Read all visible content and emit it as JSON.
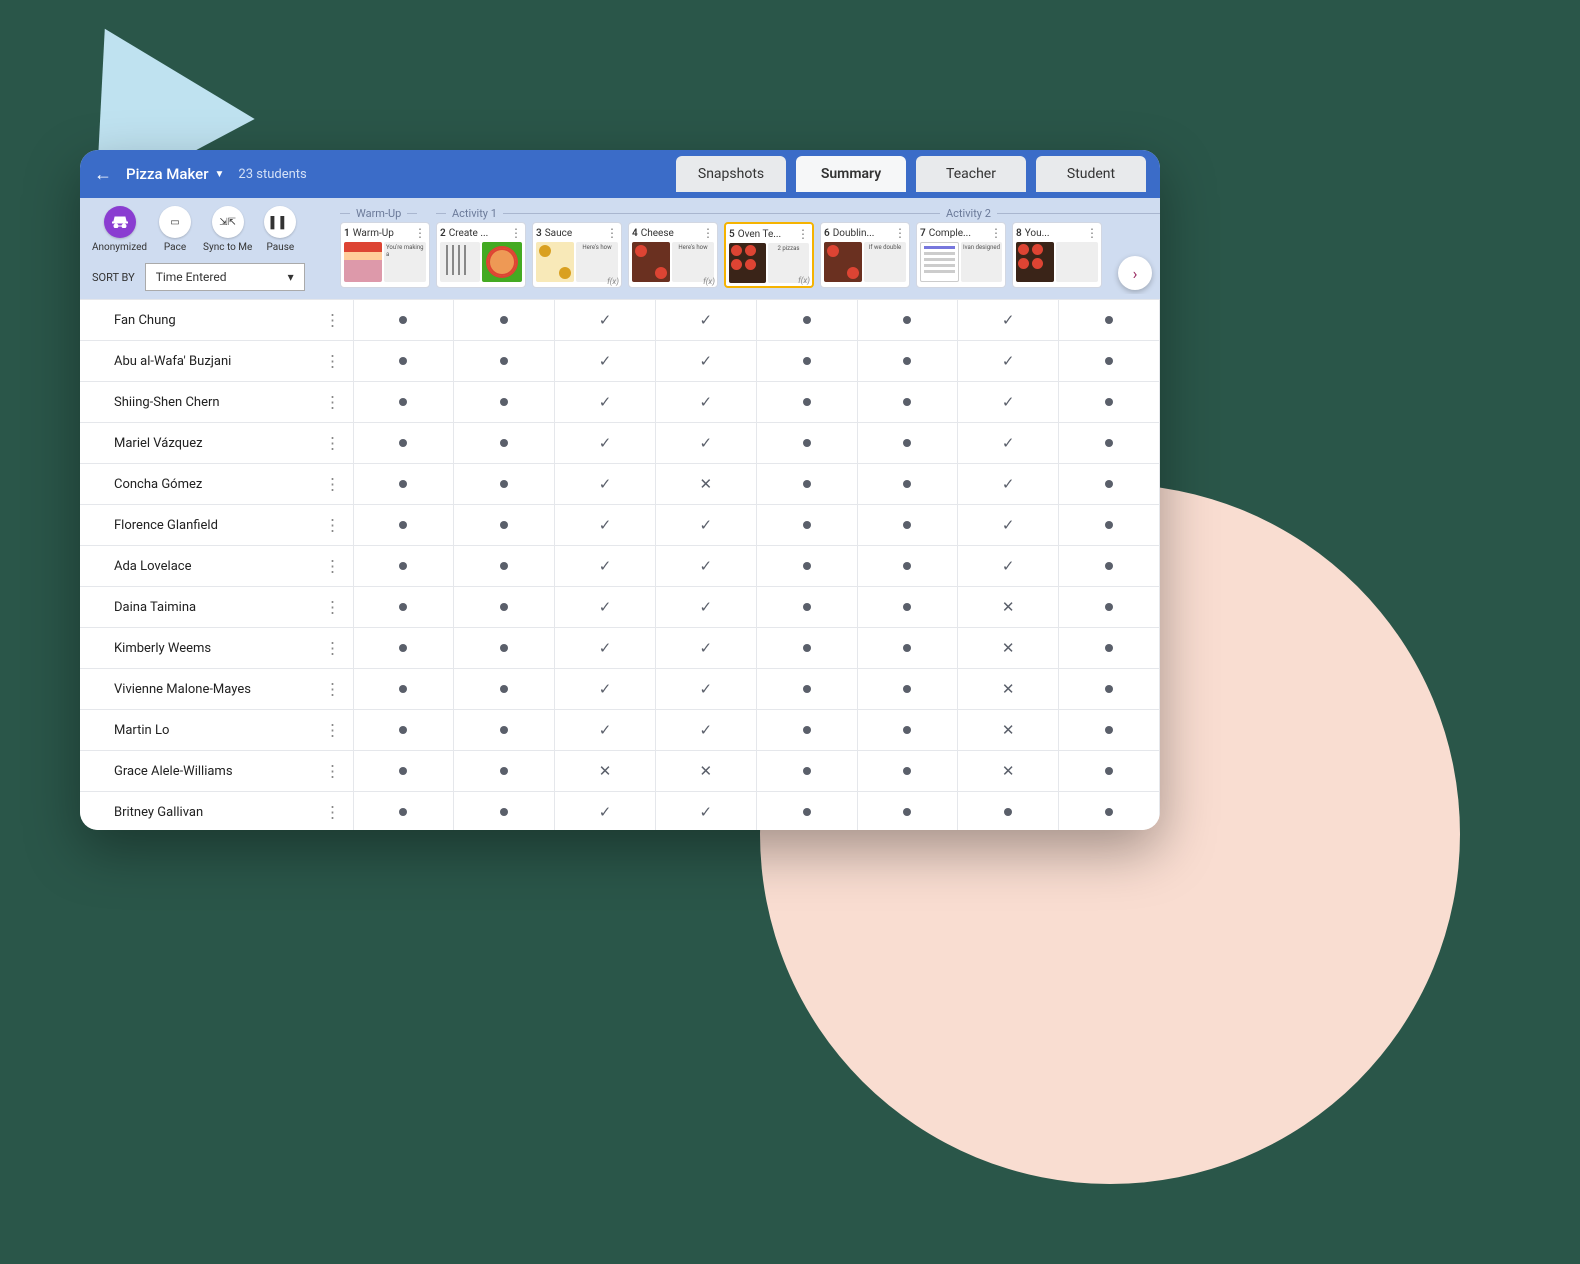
{
  "header": {
    "lesson_title": "Pizza Maker",
    "student_count": "23 students",
    "tabs": [
      "Snapshots",
      "Summary",
      "Teacher",
      "Student"
    ],
    "active_tab": "Summary"
  },
  "controls": {
    "items": [
      {
        "label": "Anonymized",
        "icon": "incognito",
        "purple": true
      },
      {
        "label": "Pace",
        "icon": "projector"
      },
      {
        "label": "Sync to Me",
        "icon": "sync"
      },
      {
        "label": "Pause",
        "icon": "pause"
      }
    ],
    "sort_label": "SORT BY",
    "sort_value": "Time Entered"
  },
  "groups": [
    "Warm-Up",
    "Activity 1",
    "Activity 2"
  ],
  "screens": [
    {
      "num": "1",
      "title": "Warm-Up",
      "caption": "You're making a",
      "thumb": "shop",
      "selected": false
    },
    {
      "num": "2",
      "title": "Create ...",
      "caption": "",
      "thumb": "tools-pizza",
      "selected": false
    },
    {
      "num": "3",
      "title": "Sauce",
      "caption": "Here's how",
      "thumb": "sauce",
      "fx": true,
      "selected": false
    },
    {
      "num": "4",
      "title": "Cheese",
      "caption": "Here's how",
      "thumb": "cheese",
      "fx": true,
      "selected": false
    },
    {
      "num": "5",
      "title": "Oven Te...",
      "caption": "2 pizzas",
      "thumb": "oven",
      "fx": true,
      "selected": true
    },
    {
      "num": "6",
      "title": "Doublin...",
      "caption": "If we double",
      "thumb": "cheese",
      "selected": false
    },
    {
      "num": "7",
      "title": "Comple...",
      "caption": "Ivan designed",
      "thumb": "worksheet",
      "selected": false
    },
    {
      "num": "8",
      "title": "You...",
      "caption": "",
      "thumb": "oven",
      "selected": false
    }
  ],
  "students": [
    {
      "name": "Fan Chung",
      "cells": [
        "dot",
        "dot",
        "check",
        "check",
        "dot",
        "dot",
        "check",
        "dot"
      ]
    },
    {
      "name": "Abu al-Wafa' Buzjani",
      "cells": [
        "dot",
        "dot",
        "check",
        "check",
        "dot",
        "dot",
        "check",
        "dot"
      ]
    },
    {
      "name": "Shiing-Shen Chern",
      "cells": [
        "dot",
        "dot",
        "check",
        "check",
        "dot",
        "dot",
        "check",
        "dot"
      ]
    },
    {
      "name": "Mariel Vázquez",
      "cells": [
        "dot",
        "dot",
        "check",
        "check",
        "dot",
        "dot",
        "check",
        "dot"
      ]
    },
    {
      "name": "Concha Gómez",
      "cells": [
        "dot",
        "dot",
        "check",
        "cross",
        "dot",
        "dot",
        "check",
        "dot"
      ]
    },
    {
      "name": "Florence Glanfield",
      "cells": [
        "dot",
        "dot",
        "check",
        "check",
        "dot",
        "dot",
        "check",
        "dot"
      ]
    },
    {
      "name": "Ada Lovelace",
      "cells": [
        "dot",
        "dot",
        "check",
        "check",
        "dot",
        "dot",
        "check",
        "dot"
      ]
    },
    {
      "name": "Daina Taimina",
      "cells": [
        "dot",
        "dot",
        "check",
        "check",
        "dot",
        "dot",
        "cross",
        "dot"
      ]
    },
    {
      "name": "Kimberly Weems",
      "cells": [
        "dot",
        "dot",
        "check",
        "check",
        "dot",
        "dot",
        "cross",
        "dot"
      ]
    },
    {
      "name": "Vivienne Malone-Mayes",
      "cells": [
        "dot",
        "dot",
        "check",
        "check",
        "dot",
        "dot",
        "cross",
        "dot"
      ]
    },
    {
      "name": "Martin Lo",
      "cells": [
        "dot",
        "dot",
        "check",
        "check",
        "dot",
        "dot",
        "cross",
        "dot"
      ]
    },
    {
      "name": "Grace Alele-Williams",
      "cells": [
        "dot",
        "dot",
        "cross",
        "cross",
        "dot",
        "dot",
        "cross",
        "dot"
      ]
    },
    {
      "name": "Britney Gallivan",
      "cells": [
        "dot",
        "dot",
        "check",
        "check",
        "dot",
        "dot",
        "dot",
        "dot"
      ]
    }
  ]
}
